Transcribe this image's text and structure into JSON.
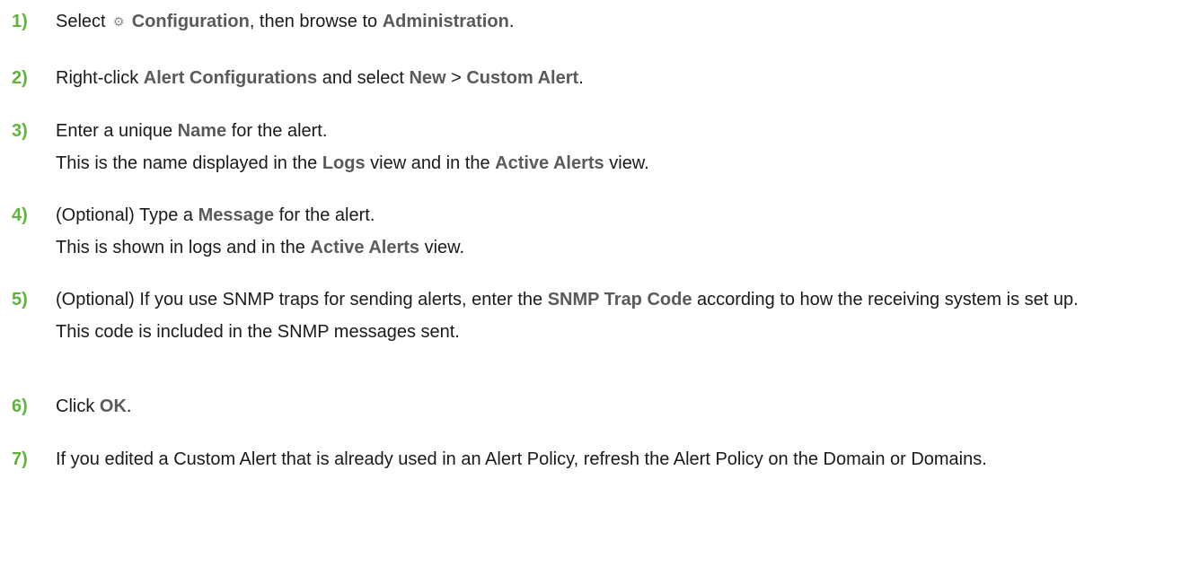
{
  "steps": [
    {
      "num": "1)",
      "line1": [
        {
          "t": "Select "
        },
        {
          "icon": "gear-icon",
          "glyph": "⚙"
        },
        {
          "t": " "
        },
        {
          "t": "Configuration",
          "ui": true
        },
        {
          "t": ", then browse to "
        },
        {
          "t": "Administration",
          "ui": true
        },
        {
          "t": "."
        }
      ]
    },
    {
      "num": "2)",
      "line1": [
        {
          "t": "Right-click "
        },
        {
          "t": "Alert Configurations",
          "ui": true
        },
        {
          "t": " and select "
        },
        {
          "t": "New",
          "ui": true
        },
        {
          "t": " > "
        },
        {
          "t": "Custom Alert",
          "ui": true
        },
        {
          "t": "."
        }
      ]
    },
    {
      "num": "3)",
      "line1": [
        {
          "t": "Enter a unique "
        },
        {
          "t": "Name",
          "ui": true
        },
        {
          "t": " for the alert."
        }
      ],
      "sub": [
        {
          "t": "This is the name displayed in the "
        },
        {
          "t": "Logs",
          "ui": true
        },
        {
          "t": " view and in the "
        },
        {
          "t": "Active Alerts",
          "ui": true
        },
        {
          "t": " view."
        }
      ]
    },
    {
      "num": "4)",
      "line1": [
        {
          "t": "(Optional) Type a "
        },
        {
          "t": "Message",
          "ui": true
        },
        {
          "t": " for the alert."
        }
      ],
      "sub": [
        {
          "t": "This is shown in logs and in the "
        },
        {
          "t": "Active Alerts",
          "ui": true
        },
        {
          "t": " view."
        }
      ]
    },
    {
      "num": "5)",
      "line1": [
        {
          "t": "(Optional) If you use SNMP traps for sending alerts, enter the "
        },
        {
          "t": "SNMP Trap Code",
          "ui": true
        },
        {
          "t": " according to how the receiving system is set up."
        }
      ],
      "sub": [
        {
          "t": "This code is included in the SNMP messages sent."
        }
      ]
    },
    {
      "num": "6)",
      "line1": [
        {
          "t": "Click "
        },
        {
          "t": "OK",
          "ui": true
        },
        {
          "t": "."
        }
      ]
    },
    {
      "num": "7)",
      "line1": [
        {
          "t": "If you edited a Custom Alert that is already used in an Alert Policy, refresh the Alert Policy on the Domain or Domains."
        }
      ]
    }
  ]
}
